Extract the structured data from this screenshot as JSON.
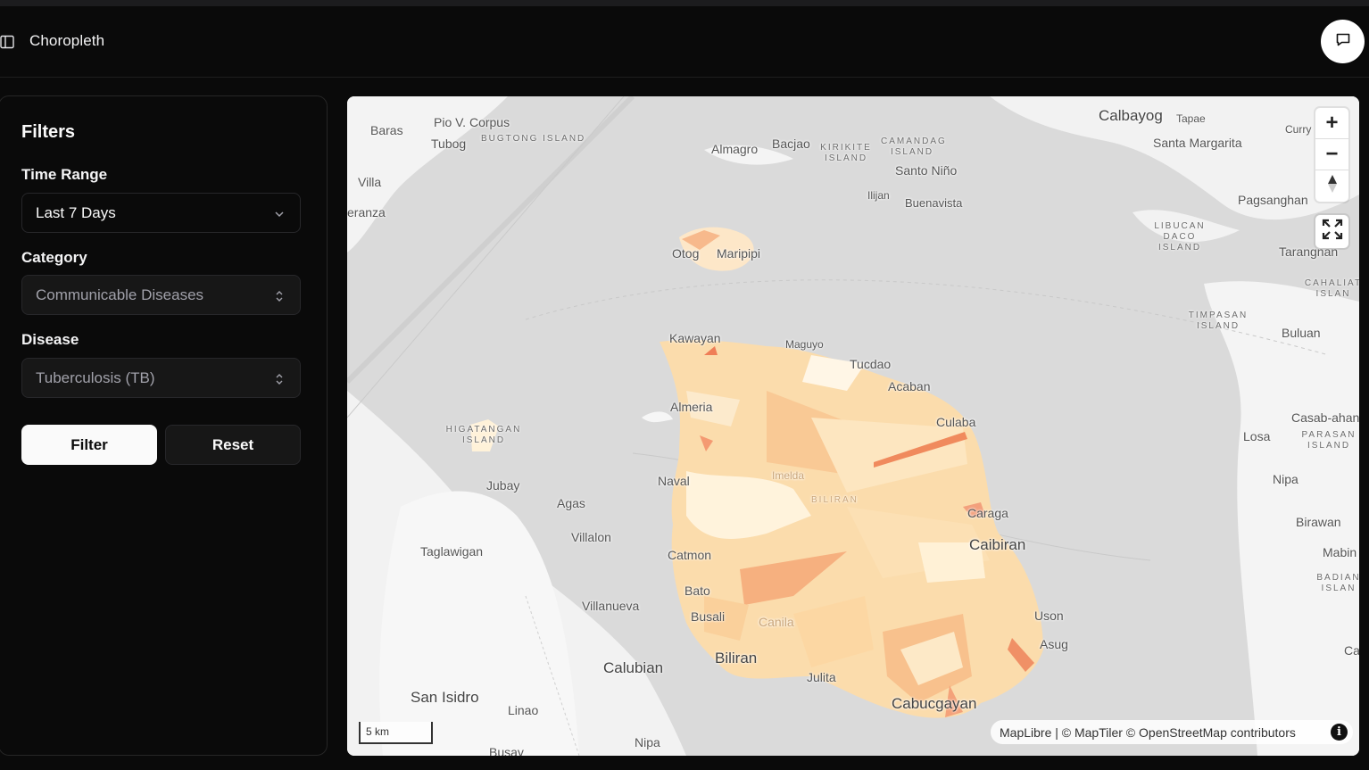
{
  "header": {
    "title": "Choropleth"
  },
  "filters": {
    "heading": "Filters",
    "time_range": {
      "label": "Time Range",
      "value": "Last 7 Days"
    },
    "category": {
      "label": "Category",
      "value": "Communicable Diseases"
    },
    "disease": {
      "label": "Disease",
      "value": "Tuberculosis (TB)"
    },
    "filter_button": "Filter",
    "reset_button": "Reset"
  },
  "map": {
    "scale": "5 km",
    "attribution": "MapLibre | © MapTiler © OpenStreetMap contributors",
    "zoom_in_symbol": "+",
    "zoom_out_symbol": "−",
    "info_symbol": "i",
    "place_labels": [
      "Baras",
      "Pio V. Corpus",
      "Tubog",
      "BUGTONG ISLAND",
      "Villa",
      "eranza",
      "Almagro",
      "Bacjao",
      "KIRIKITE ISLAND",
      "CAMANDAG ISLAND",
      "Santo Niño",
      "Ilijan",
      "Buenavista",
      "Calbayog",
      "Tapae",
      "Santa Margarita",
      "Curry",
      "Pagsanghan",
      "LIBUCAN DACO ISLAND",
      "Tarangnan",
      "CAHALIAT ISLAN",
      "TIMPASAN ISLAND",
      "Buluan",
      "Casab-ahan",
      "PARASAN ISLAND",
      "Losa",
      "Nipa",
      "Birawan",
      "Mabin",
      "BADIAN ISLAN",
      "Ca",
      "Kawayan",
      "Maguyo",
      "Tucdao",
      "Acaban",
      "Almeria",
      "Culaba",
      "HIGATANGAN ISLAND",
      "Jubay",
      "Agas",
      "Villalon",
      "Naval",
      "Imelda",
      "BILIRAN",
      "Taglawigan",
      "Caraga",
      "Caibiran",
      "Catmon",
      "Bato",
      "Busali",
      "Canila",
      "Villanueva",
      "Uson",
      "Asug",
      "Calubian",
      "Biliran",
      "Julita",
      "San Isidro",
      "Linao",
      "Cabucgayan",
      "Nipa",
      "Busay",
      "Otog",
      "Maripipi"
    ]
  }
}
